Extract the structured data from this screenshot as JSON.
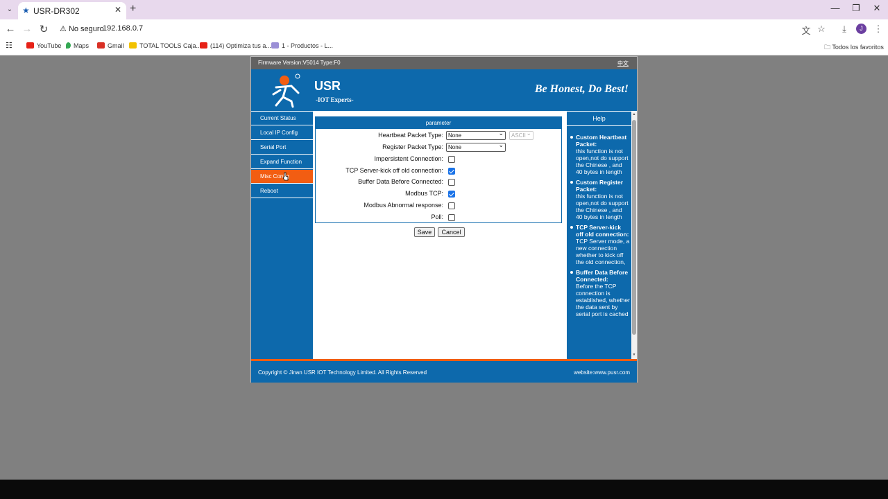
{
  "browser": {
    "tab_title": "USR-DR302",
    "tab_menu_icon": "⌄",
    "tab_close_icon": "✕",
    "new_tab_icon": "+",
    "security_label": "No seguro",
    "url": "192.168.0.7",
    "bookmarks": [
      {
        "label": "YouTube",
        "color": "#e62117"
      },
      {
        "label": "Maps",
        "color": "#34a853"
      },
      {
        "label": "Gmail",
        "color": "#d93025"
      },
      {
        "label": "TOTAL TOOLS Caja...",
        "color": "#f2c200"
      },
      {
        "label": "(114) Optimiza tus a...",
        "color": "#e62117"
      },
      {
        "label": "1 - Productos - L...",
        "color": "#9b8fd6"
      }
    ],
    "all_bookmarks_label": "Todos los favoritos",
    "profile_initial": "J"
  },
  "device": {
    "firmware": "Firmware Version:V5014 Type:F0",
    "language_link": "中文",
    "brand": "USR",
    "brand_sub": "-IOT Experts-",
    "slogan": "Be Honest, Do Best!",
    "menu": [
      {
        "label": "Current Status",
        "active": false
      },
      {
        "label": "Local IP Config",
        "active": false
      },
      {
        "label": "Serial Port",
        "active": false
      },
      {
        "label": "Expand Function",
        "active": false
      },
      {
        "label": "Misc Config",
        "active": true
      },
      {
        "label": "Reboot",
        "active": false
      }
    ],
    "panel_title": "parameter",
    "fields": {
      "heartbeat_label": "Heartbeat Packet Type:",
      "heartbeat_value": "None",
      "heartbeat_format": "ASCII",
      "register_label": "Register Packet Type:",
      "register_value": "None",
      "impersistent_label": "Impersistent Connection:",
      "impersistent_checked": false,
      "kickoff_label": "TCP Server-kick off old connection:",
      "kickoff_checked": true,
      "buffer_label": "Buffer Data Before Connected:",
      "buffer_checked": false,
      "modbus_label": "Modbus TCP:",
      "modbus_checked": true,
      "modbus_abnormal_label": "Modbus Abnormal response:",
      "modbus_abnormal_checked": false,
      "poll_label": "Poll:",
      "poll_checked": false
    },
    "save_label": "Save",
    "cancel_label": "Cancel",
    "help_title": "Help",
    "help_items": [
      {
        "title": "Custom Heartbeat Packet:",
        "text": "this function is not open,not do support the Chinese , and 40 bytes in length"
      },
      {
        "title": "Custom Register Packet:",
        "text": "this function is not open,not do support the Chinese , and 40 bytes in length"
      },
      {
        "title": "TCP Server-kick off old connection:",
        "text": "TCP Server mode, a new connection whether to kick off the old connection,"
      },
      {
        "title": "Buffer Data Before Connected:",
        "text": "Before the TCP connection is established, whether the data sent by serial port is cached"
      }
    ],
    "copyright": "Copyright © Jinan USR IOT Technology Limited. All Rights Reserved",
    "website_label": "website:",
    "website_link": "www.pusr.com"
  }
}
